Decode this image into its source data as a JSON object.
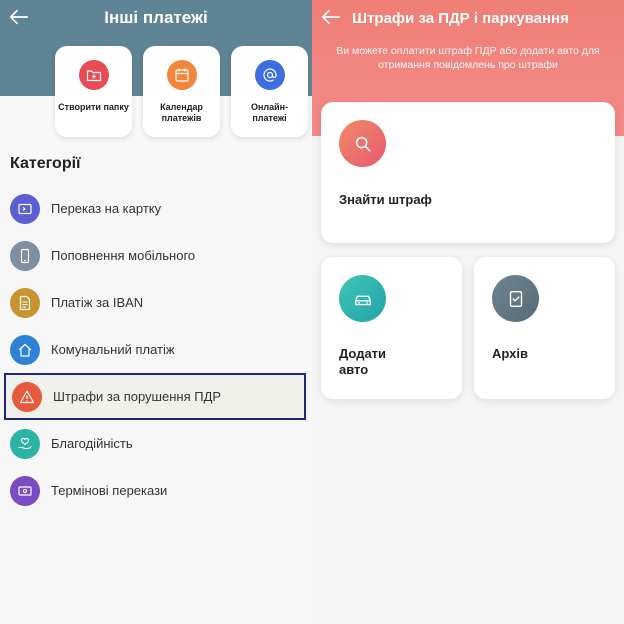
{
  "left": {
    "title": "Інші платежі",
    "tiles": [
      {
        "label": "Створити папку",
        "color": "#e94b53",
        "icon": "folder-plus-icon"
      },
      {
        "label": "Календар платежів",
        "color": "#f2873c",
        "icon": "calendar-icon"
      },
      {
        "label": "Онлайн-платежі",
        "color": "#3d6ee0",
        "icon": "at-icon"
      }
    ],
    "section_title": "Категорії",
    "categories": [
      {
        "label": "Переказ на картку",
        "color": "#5b5fd1",
        "icon": "card-transfer-icon"
      },
      {
        "label": "Поповнення мобільного",
        "color": "#7e8fa0",
        "icon": "mobile-icon"
      },
      {
        "label": "Платіж за IBAN",
        "color": "#c9932f",
        "icon": "document-icon"
      },
      {
        "label": "Комунальний платіж",
        "color": "#2d82d8",
        "icon": "home-icon"
      },
      {
        "label": "Штрафи за порушення ПДР",
        "color": "#e85a3c",
        "icon": "warning-icon",
        "selected": true
      },
      {
        "label": "Благодійність",
        "color": "#2bb3a4",
        "icon": "charity-hand-icon"
      },
      {
        "label": "Термінові перекази",
        "color": "#7b4bc2",
        "icon": "money-transfer-icon"
      }
    ]
  },
  "right": {
    "title": "Штрафи за ПДР і паркування",
    "subtitle": "Ви можете оплатити штраф ПДР або додати авто для отримання повідомлень про штрафи",
    "cards": {
      "find": {
        "label": "Знайти штраф",
        "color": "#ee6a62",
        "icon": "search-icon"
      },
      "add_car": {
        "label": "Додати авто",
        "color": "#2ab1ad",
        "icon": "car-icon"
      },
      "archive": {
        "label": "Архів",
        "color": "#5e7580",
        "icon": "archive-icon"
      }
    }
  }
}
